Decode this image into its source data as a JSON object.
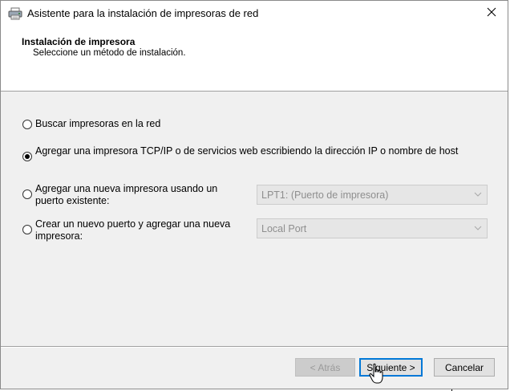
{
  "window": {
    "title": "Asistente para la instalación de impresoras de red",
    "close_glyph": "✕"
  },
  "header": {
    "title": "Instalación de impresora",
    "subtitle": "Seleccione un método de instalación."
  },
  "options": [
    {
      "label": "Buscar impresoras en la red",
      "checked": false
    },
    {
      "label": "Agregar una impresora TCP/IP o de servicios web escribiendo la dirección IP o nombre de host",
      "checked": true
    },
    {
      "label": "Agregar una nueva impresora usando un puerto existente:",
      "checked": false,
      "select_value": "LPT1: (Puerto de impresora)"
    },
    {
      "label": "Crear un nuevo puerto y agregar una nueva impresora:",
      "checked": false,
      "select_value": "Local Port"
    }
  ],
  "buttons": {
    "back": "< Atrás",
    "next": "Siguiente >",
    "cancel": "Cancelar"
  },
  "colors": {
    "focus_border": "#0078d7",
    "disabled_text": "#8e8e8e"
  },
  "icons": {
    "title": "printer-icon",
    "close": "close-icon",
    "dropdown": "chevron-down-icon",
    "cursor": "hand-pointer-icon"
  }
}
